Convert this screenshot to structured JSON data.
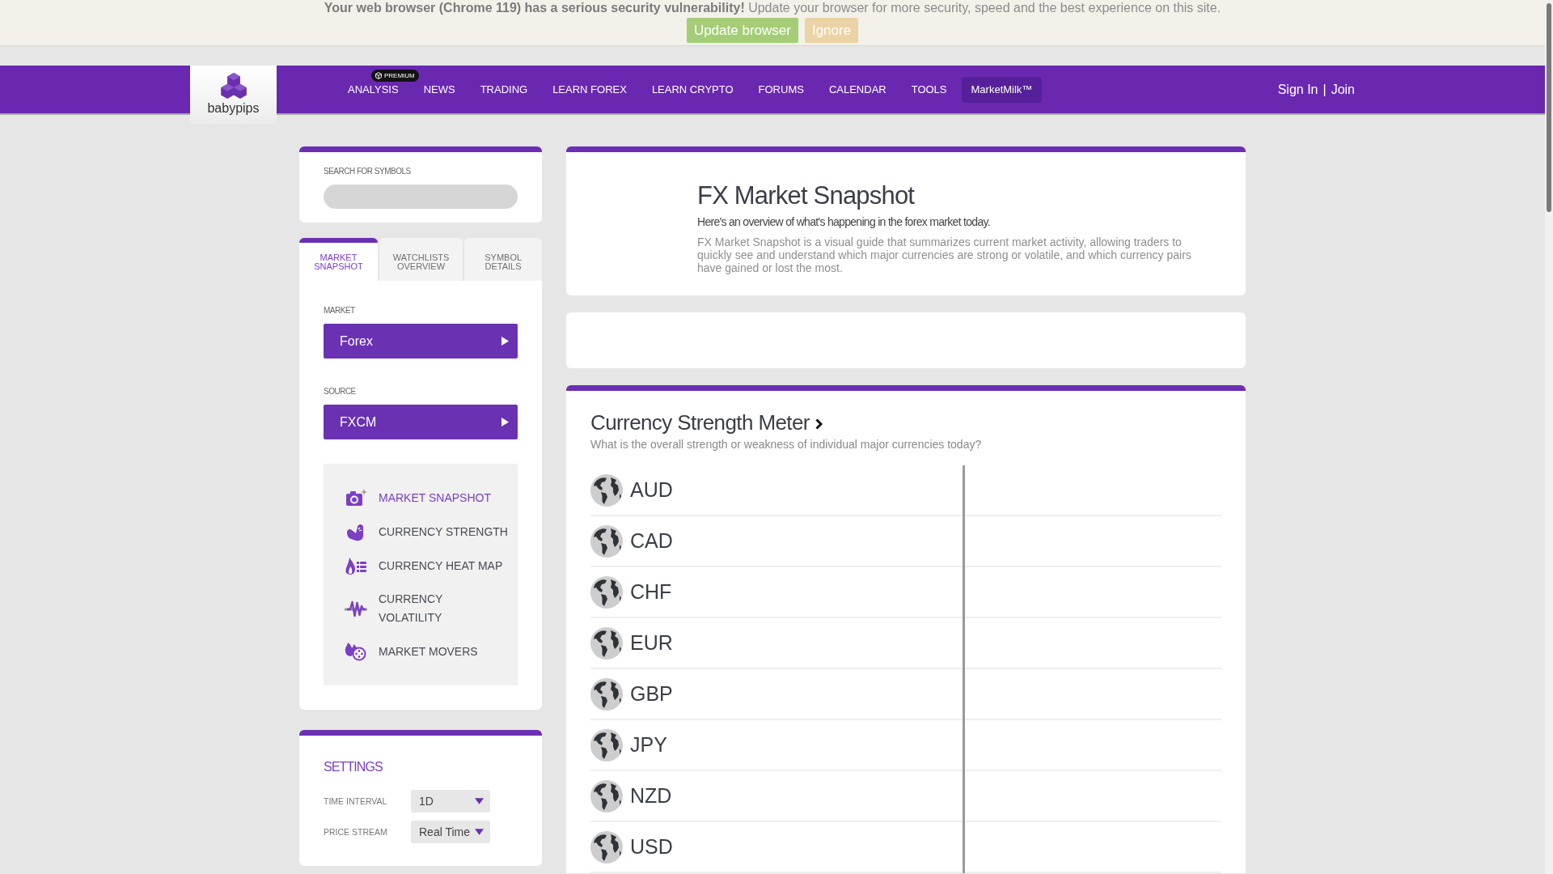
{
  "update_banner": {
    "message": "**Your web browser (Chrome 119) has a serious security vulnerability!** Update your browser for more security, speed and the best experience on this site.",
    "buttons": [
      {
        "label": "Update browser",
        "kind": "primary"
      },
      {
        "label": "Ignore",
        "kind": "secondary"
      }
    ]
  },
  "header": {
    "logo_text": "babypips",
    "nav": [
      {
        "label": "ANALYSIS",
        "kind": "link",
        "badge": "PREMIUM"
      },
      {
        "label": "NEWS",
        "kind": "link"
      },
      {
        "label": "TRADING",
        "kind": "link"
      },
      {
        "label": "LEARN FOREX",
        "kind": "link"
      },
      {
        "label": "LEARN CRYPTO",
        "kind": "link"
      },
      {
        "label": "FORUMS",
        "kind": "link"
      },
      {
        "label": "CALENDAR",
        "kind": "link"
      },
      {
        "label": "TOOLS",
        "kind": "link"
      },
      {
        "label": "MarketMilk™",
        "kind": "button"
      }
    ],
    "account": {
      "sign_in": "Sign In",
      "separator": "|",
      "join": "Join"
    }
  },
  "symbol_search": {
    "label": "SEARCH FOR SYMBOLS"
  },
  "sidebar_tabs": [
    {
      "label": "MARKET SNAPSHOT",
      "selected": true
    },
    {
      "label": "WATCHLISTS OVERVIEW",
      "selected": false
    },
    {
      "label": "SYMBOL DETAILS",
      "selected": false
    }
  ],
  "market": {
    "label": "MARKET",
    "value": "Forex"
  },
  "source": {
    "label": "SOURCE",
    "value": "FXCM"
  },
  "tools_menu": [
    {
      "label": "MARKET SNAPSHOT",
      "kind": "snapshot",
      "selected": true
    },
    {
      "label": "CURRENCY STRENGTH",
      "kind": "strength",
      "selected": false
    },
    {
      "label": "CURRENCY HEAT MAP",
      "kind": "heatmap",
      "selected": false
    },
    {
      "label": "CURRENCY\nVOLATILITY",
      "kind": "volatility",
      "selected": false
    },
    {
      "label": "MARKET MOVERS",
      "kind": "movers",
      "selected": false
    }
  ],
  "settings": {
    "title": "SETTINGS",
    "fields": [
      {
        "label": "TIME INTERVAL",
        "value": "1D"
      },
      {
        "label": "PRICE STREAM",
        "value": "Real Time"
      }
    ]
  },
  "snapshot_intro": {
    "title": "FX Market Snapshot",
    "subtitle": "Here's an overview of what's happening in the forex market today.",
    "description": "FX Market Snapshot is a visual guide that summarizes current market activity, allowing traders to quickly see and understand which major currencies are strong or volatile, and which currency pairs have gained or lost the most."
  },
  "strength_meter": {
    "title": "Currency Strength Meter",
    "subtitle": "What is the overall strength or weakness of individual major currencies today?",
    "currencies": [
      "AUD",
      "CAD",
      "CHF",
      "EUR",
      "GBP",
      "JPY",
      "NZD",
      "USD"
    ]
  }
}
